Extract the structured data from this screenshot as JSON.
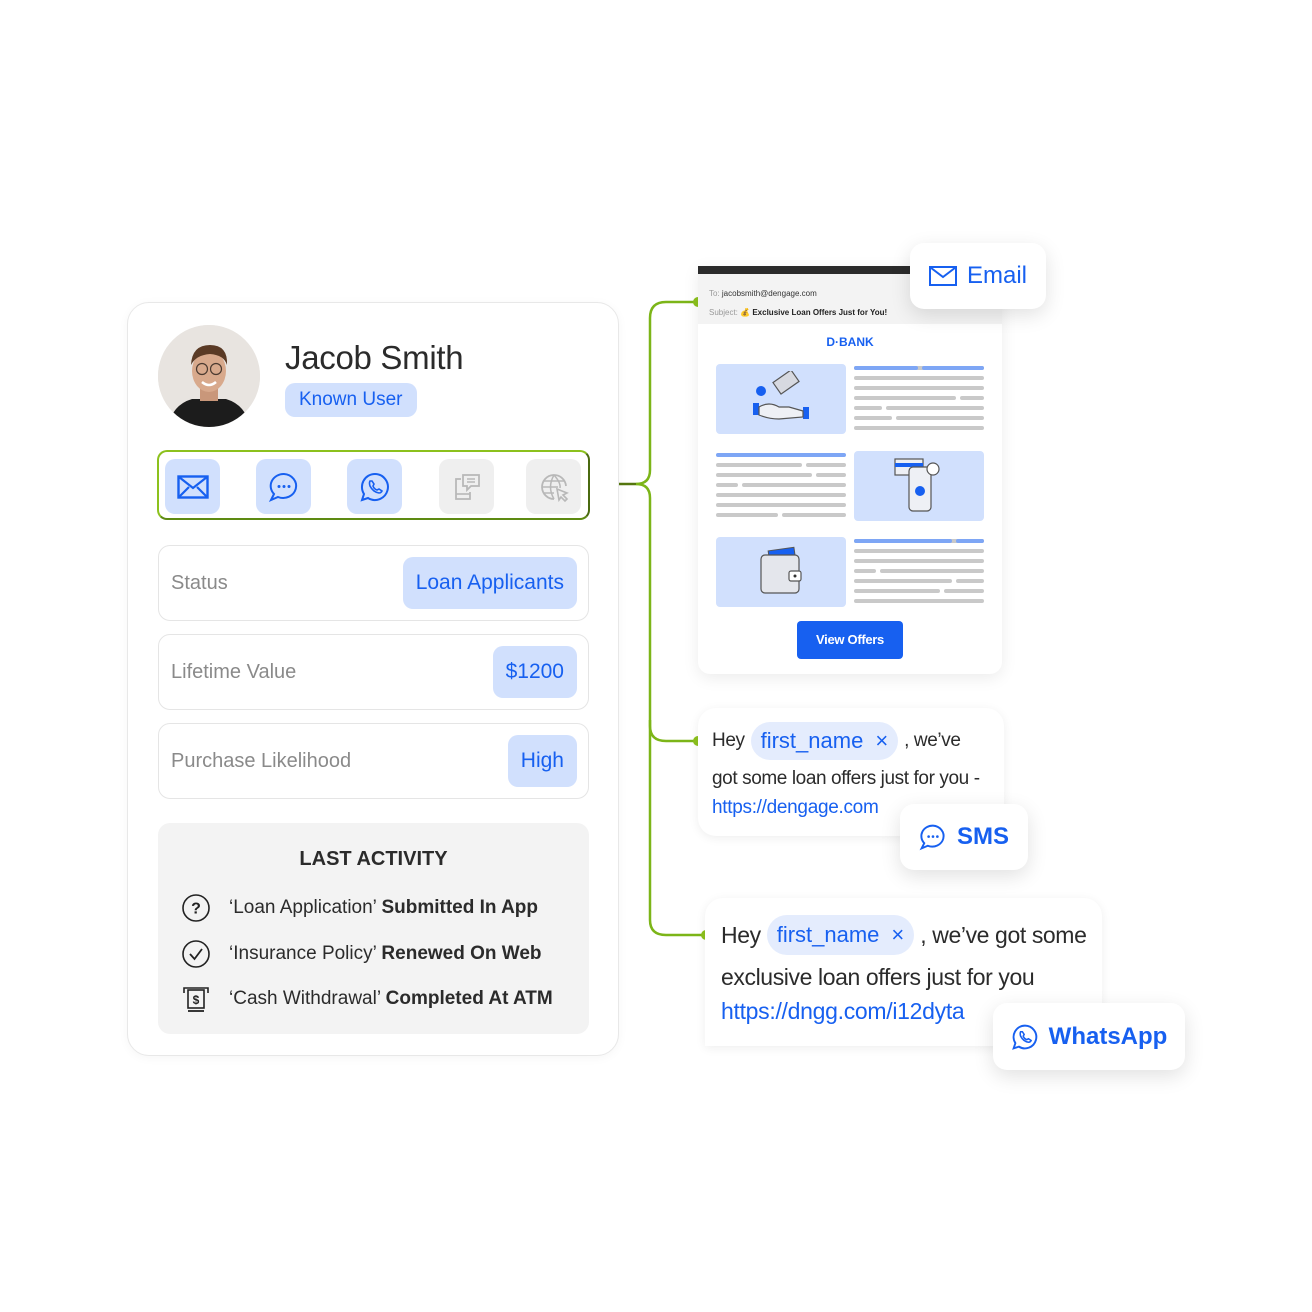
{
  "profile": {
    "name": "Jacob Smith",
    "badge": "Known User",
    "channels": [
      {
        "name": "email",
        "icon": "envelope-icon",
        "active": true
      },
      {
        "name": "sms",
        "icon": "chat-bubble-icon",
        "active": true
      },
      {
        "name": "whatsapp",
        "icon": "whatsapp-icon",
        "active": true
      },
      {
        "name": "in-app",
        "icon": "mobile-message-icon",
        "active": false
      },
      {
        "name": "web-push",
        "icon": "globe-cursor-icon",
        "active": false
      }
    ],
    "stats": [
      {
        "label": "Status",
        "value": "Loan Applicants"
      },
      {
        "label": "Lifetime Value",
        "value": "$1200"
      },
      {
        "label": "Purchase Likelihood",
        "value": "High"
      }
    ],
    "last_activity": {
      "title": "LAST ACTIVITY",
      "items": [
        {
          "icon": "question-circle-icon",
          "event": "‘Loan Application’",
          "action": "Submitted In App"
        },
        {
          "icon": "check-circle-icon",
          "event": "‘Insurance Policy’",
          "action": "Renewed On Web"
        },
        {
          "icon": "atm-cash-icon",
          "event": "‘Cash Withdrawal’",
          "action": "Completed At ATM"
        }
      ]
    }
  },
  "email": {
    "to_label": "To:",
    "to": "jacobsmith@dengage.com",
    "subject_label": "Subject:",
    "subject_emoji": "💰",
    "subject": "Exclusive Loan Offers Just for You!",
    "brand": "D·BANK",
    "cta": "View Offers",
    "channel_label": "Email"
  },
  "sms": {
    "greeting": "Hey",
    "token": "first_name",
    "token_remove": "×",
    "after_token": ", we’ve",
    "line2": "got some loan offers just for you -",
    "link": "https://dengage.com",
    "channel_label": "SMS"
  },
  "whatsapp": {
    "greeting": "Hey",
    "token": "first_name",
    "token_remove": "×",
    "after_token": ", we’ve got some",
    "line2": "exclusive loan offers just for you",
    "link": "https://dngg.com/i12dyta",
    "channel_label": "WhatsApp"
  },
  "colors": {
    "accent": "#1760f0",
    "accent_light": "#d1e0fd",
    "connector": "#7cb518",
    "muted": "#8a8a8a"
  }
}
